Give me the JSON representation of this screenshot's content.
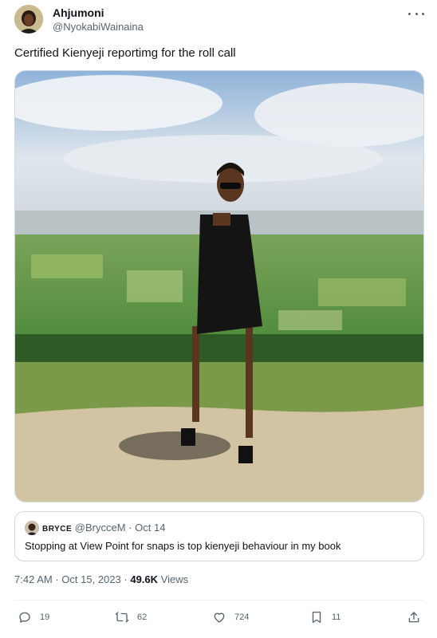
{
  "author": {
    "display_name": "Ahjumoni",
    "handle": "@NyokabiWainaina"
  },
  "tweet": {
    "text": "Certified Kienyeji reportimg for the roll call"
  },
  "quote": {
    "name": "BRYCE",
    "handle": "@BrycceM",
    "separator": "·",
    "date": "Oct 14",
    "text": "Stopping at View Point for snaps is top kienyeji behaviour in my book"
  },
  "meta": {
    "time": "7:42 AM",
    "separator": "·",
    "date": "Oct 15, 2023",
    "separator2": "·",
    "views_count": "49.6K",
    "views_label": "Views"
  },
  "actions": {
    "replies": "19",
    "retweets": "62",
    "likes": "724",
    "bookmarks": "11"
  },
  "colors": {
    "text": "#0f1419",
    "secondary": "#536471",
    "border": "#cfd9de"
  },
  "icons": [
    "more-icon",
    "reply-icon",
    "retweet-icon",
    "like-icon",
    "bookmark-icon",
    "share-icon"
  ]
}
